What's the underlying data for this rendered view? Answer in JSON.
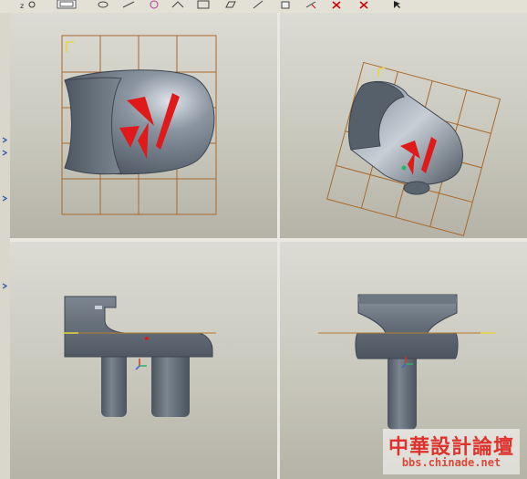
{
  "toolbar": {
    "icons": [
      "zoom-icon",
      "view-icon",
      "spin-icon",
      "sketch-icon",
      "orient-icon",
      "saved-view-icon",
      "layer-icon",
      "datum-plane-icon",
      "datum-axis-icon",
      "datum-point-icon",
      "csys-icon",
      "delete-icon",
      "cursor-icon"
    ]
  },
  "viewports": [
    "top-view",
    "isometric-view",
    "front-view",
    "side-view"
  ],
  "watermark": {
    "title": "中華設計論壇",
    "url": "bbs.chinade.net"
  },
  "colors": {
    "model": "#5d6772",
    "logo": "#e01a1a",
    "grid": "#a8692a",
    "axis": "#b87a2a",
    "background": "#d4d3ca",
    "watermark_red": "#e0322c"
  }
}
